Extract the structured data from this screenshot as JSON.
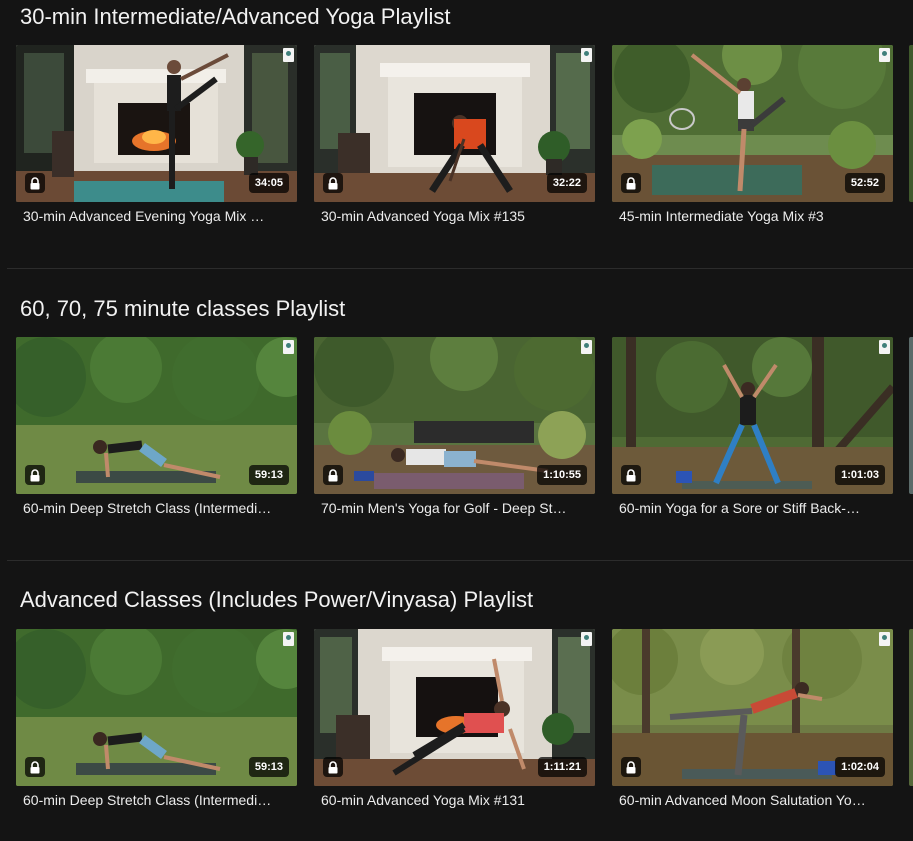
{
  "sections": [
    {
      "title": "30-min Intermediate/Advanced Yoga Playlist",
      "cards": [
        {
          "title": "30-min Advanced Evening Yoga Mix …",
          "duration": "34:05",
          "scene": "fireplace-standing"
        },
        {
          "title": "30-min Advanced Yoga Mix #135",
          "duration": "32:22",
          "scene": "fireplace-lunge"
        },
        {
          "title": "45-min Intermediate Yoga Mix #3",
          "duration": "52:52",
          "scene": "garden-dancer"
        }
      ]
    },
    {
      "title": "60, 70, 75 minute classes Playlist",
      "cards": [
        {
          "title": "60-min Deep Stretch Class (Intermedi…",
          "duration": "59:13",
          "scene": "park-bridge"
        },
        {
          "title": "70-min Men's Yoga for Golf - Deep St…",
          "duration": "1:10:55",
          "scene": "garden-plank"
        },
        {
          "title": "60-min Yoga for a Sore or Stiff Back-…",
          "duration": "1:01:03",
          "scene": "forest-star"
        }
      ]
    },
    {
      "title": "Advanced Classes (Includes Power/Vinyasa) Playlist",
      "cards": [
        {
          "title": "60-min Deep Stretch Class (Intermedi…",
          "duration": "59:13",
          "scene": "park-bridge"
        },
        {
          "title": "60-min Advanced Yoga Mix #131",
          "duration": "1:11:21",
          "scene": "fireplace-sideplank"
        },
        {
          "title": "60-min Advanced Moon Salutation Yo…",
          "duration": "1:02:04",
          "scene": "forest-warrior3"
        }
      ]
    }
  ],
  "colors": {
    "background": "#141414",
    "divider": "#2c2c2c",
    "title_text": "#f2f2f2",
    "badge_bg": "#000000"
  },
  "icons": {
    "lock": "lock-icon",
    "badge": "channel-badge-icon"
  }
}
